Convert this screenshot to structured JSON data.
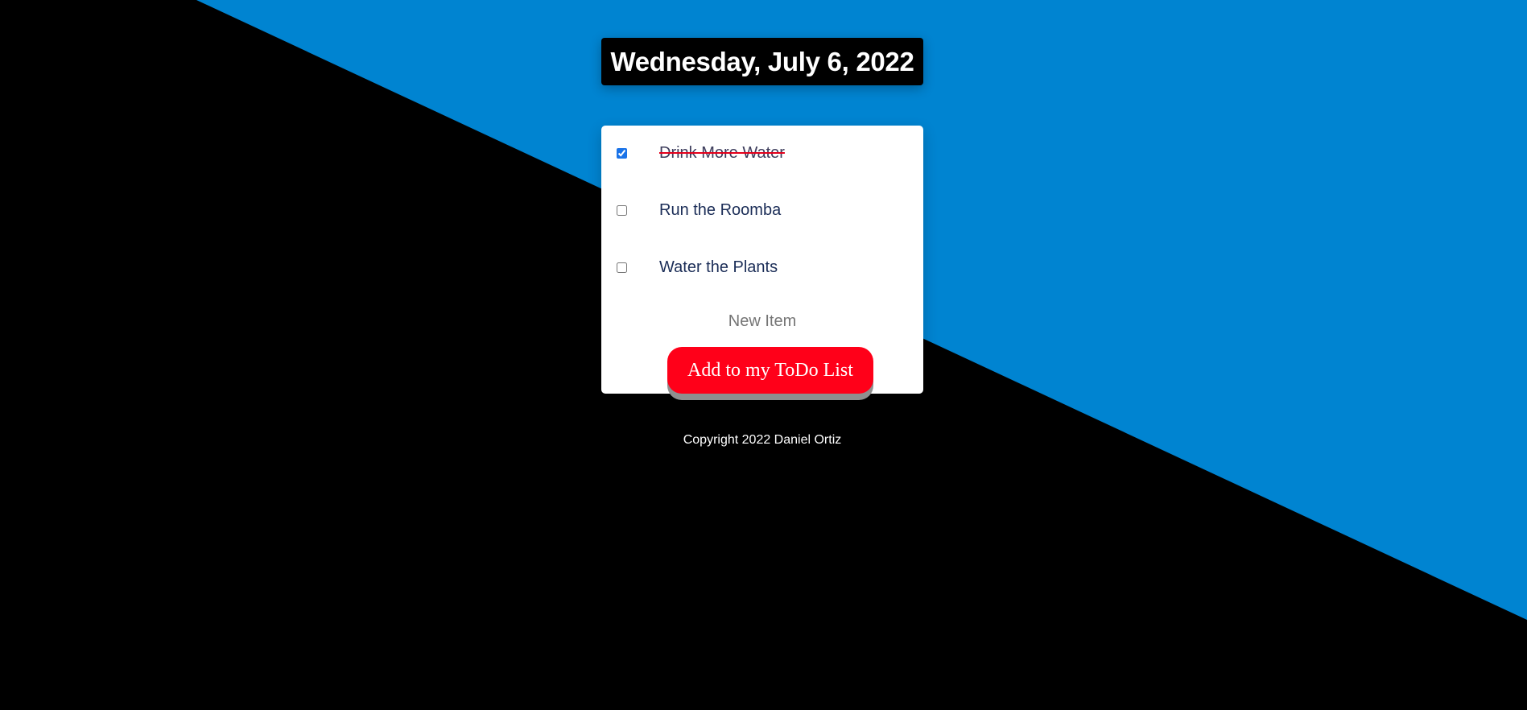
{
  "colors": {
    "background_dark": "#000000",
    "background_accent": "#0084d1",
    "card": "#ffffff",
    "button": "#ff0019",
    "button_shadow": "#8f8f8f",
    "strike": "#e3001b",
    "item_text": "#1b2d57"
  },
  "header": {
    "date": "Wednesday, July 6, 2022"
  },
  "todo": {
    "items": [
      {
        "label": "Drink More Water",
        "checked": true
      },
      {
        "label": "Run the Roomba",
        "checked": false
      },
      {
        "label": "Water the Plants",
        "checked": false
      }
    ],
    "new_item_placeholder": "New Item",
    "add_button_label": "Add to my ToDo List"
  },
  "footer": {
    "copyright": "Copyright 2022 Daniel Ortiz"
  }
}
